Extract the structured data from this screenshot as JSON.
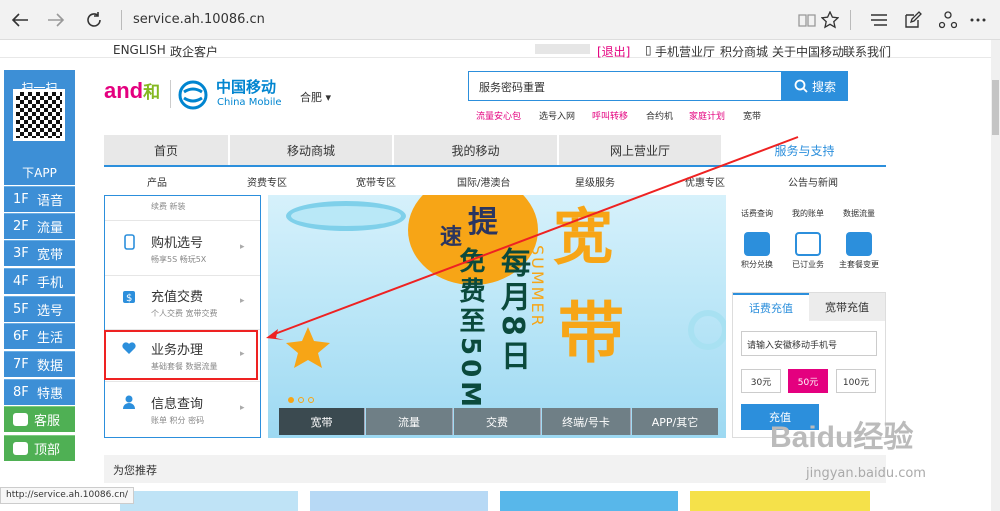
{
  "browser": {
    "url": "service.ah.10086.cn"
  },
  "toplinks": {
    "left": [
      "ENGLISH",
      "政企客户"
    ],
    "right": [
      "[退出]",
      "手机营业厅",
      "积分商城",
      "关于中国移动",
      "联系我们"
    ]
  },
  "sidebar": {
    "scan": "扫一扫",
    "download": "下APP",
    "floors": [
      {
        "num": "1F",
        "label": "语音"
      },
      {
        "num": "2F",
        "label": "流量"
      },
      {
        "num": "3F",
        "label": "宽带"
      },
      {
        "num": "4F",
        "label": "手机"
      },
      {
        "num": "5F",
        "label": "选号"
      },
      {
        "num": "6F",
        "label": "生活"
      },
      {
        "num": "7F",
        "label": "数据"
      },
      {
        "num": "8F",
        "label": "特惠"
      }
    ],
    "service": "客服",
    "top": "顶部"
  },
  "header": {
    "brand_and": "and",
    "brand_he": "和",
    "cm_name": "中国移动",
    "cm_en": "China Mobile",
    "city": "合肥"
  },
  "search": {
    "value": "服务密码重置",
    "button": "搜索",
    "hot": [
      "流量安心包",
      "选号入网",
      "呼叫转移",
      "合约机",
      "家庭计划",
      "宽带"
    ]
  },
  "nav": {
    "tabs": [
      "首页",
      "移动商城",
      "我的移动",
      "网上营业厅",
      "服务与支持"
    ],
    "sub": [
      "产品",
      "资费专区",
      "宽带专区",
      "国际/港澳台",
      "星级服务",
      "优惠专区",
      "公告与新闻"
    ]
  },
  "menu": {
    "items": [
      {
        "title": "",
        "sub": "续费   新装"
      },
      {
        "title": "购机选号",
        "sub": "畅享5S   畅玩5X"
      },
      {
        "title": "充值交费",
        "sub": "个人交费   宽带交费"
      },
      {
        "title": "业务办理",
        "sub": "基础套餐   数据流量"
      },
      {
        "title": "信息查询",
        "sub": "账单   积分   密码"
      }
    ]
  },
  "banner": {
    "ti": "提",
    "su": "速",
    "kuan": "宽",
    "dai": "带",
    "vertical1": "每月8日",
    "vertical2": "免费至50M",
    "summer": "SUMMER",
    "tabs": [
      "宽带",
      "流量",
      "交费",
      "终端/号卡",
      "APP/其它"
    ]
  },
  "services": [
    "话费查询",
    "我的账单",
    "数据流量",
    "积分兑换",
    "已订业务",
    "主套餐变更"
  ],
  "recharge": {
    "tab_active": "话费充值",
    "tab_other": "宽带充值",
    "placeholder": "请输入安徽移动手机号",
    "amounts": [
      "30元",
      "50元",
      "100元"
    ],
    "pay": "充值"
  },
  "recommend": {
    "label": "为您推荐"
  },
  "status": {
    "url": "http://service.ah.10086.cn/"
  },
  "watermark": {
    "text": "Baidu经验",
    "url": "jingyan.baidu.com"
  }
}
